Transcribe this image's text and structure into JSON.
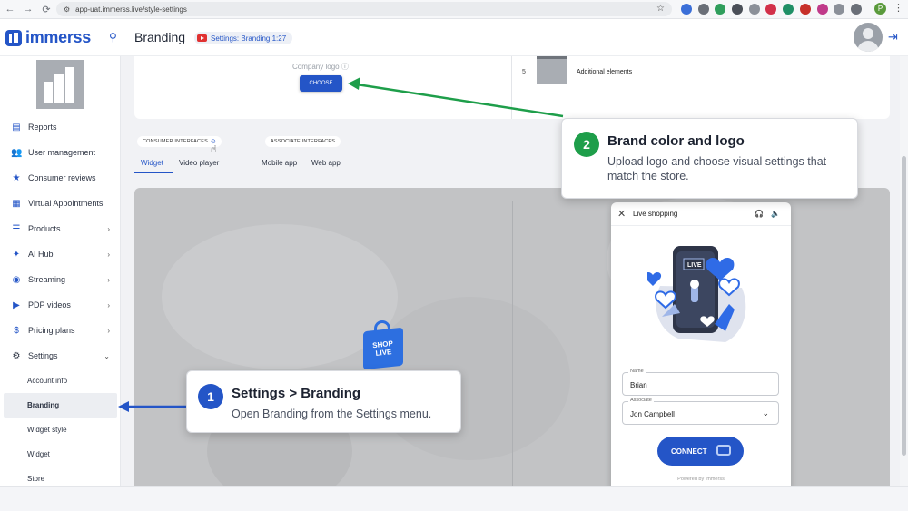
{
  "browser": {
    "url": "app-uat.immerss.live/style-settings",
    "profile_initial": "P"
  },
  "header": {
    "brand": "immerss",
    "page_title": "Branding",
    "video_badge": "Settings: Branding 1:27"
  },
  "sidebar": {
    "items": [
      {
        "label": "Reports",
        "icon": "chart-icon"
      },
      {
        "label": "User management",
        "icon": "users-icon"
      },
      {
        "label": "Consumer reviews",
        "icon": "star-icon"
      },
      {
        "label": "Virtual Appointments",
        "icon": "calendar-icon"
      },
      {
        "label": "Products",
        "icon": "list-icon"
      },
      {
        "label": "AI Hub",
        "icon": "sparkle-icon"
      },
      {
        "label": "Streaming",
        "icon": "broadcast-icon"
      },
      {
        "label": "PDP videos",
        "icon": "video-icon"
      },
      {
        "label": "Pricing plans",
        "icon": "dollar-icon"
      },
      {
        "label": "Settings",
        "icon": "gear-icon"
      }
    ],
    "sub_items": [
      "Account info",
      "Branding",
      "Widget style",
      "Widget",
      "Store"
    ]
  },
  "top_panel": {
    "company_logo_label": "Company logo",
    "choose_label": "CHOOSE",
    "row_number": "5",
    "row_label": "Additional elements"
  },
  "tabs": {
    "consumer_chip": "CONSUMER INTERFACES",
    "associate_chip": "ASSOCIATE INTERFACES",
    "consumer_tabs": [
      "Widget",
      "Video player"
    ],
    "associate_tabs": [
      "Mobile app",
      "Web app"
    ]
  },
  "preview": {
    "bag_text_line1": "SHOP",
    "bag_text_line2": "LIVE"
  },
  "widget": {
    "title": "Live shopping",
    "live_label": "LIVE",
    "name_label": "Name",
    "name_value": "Brian",
    "associate_label": "Associate",
    "associate_value": "Jon Campbell",
    "connect_label": "CONNECT",
    "powered_by": "Powered by Immerss"
  },
  "callouts": [
    {
      "number": "1",
      "title": "Settings > Branding",
      "desc": "Open Branding from the Settings menu.",
      "color": "#2455c7"
    },
    {
      "number": "2",
      "title": "Brand color and logo",
      "desc": "Upload logo and choose visual settings that match the store.",
      "color": "#1e9e4a"
    }
  ],
  "colors": {
    "accent": "#2455c7",
    "green": "#1e9e4a"
  }
}
